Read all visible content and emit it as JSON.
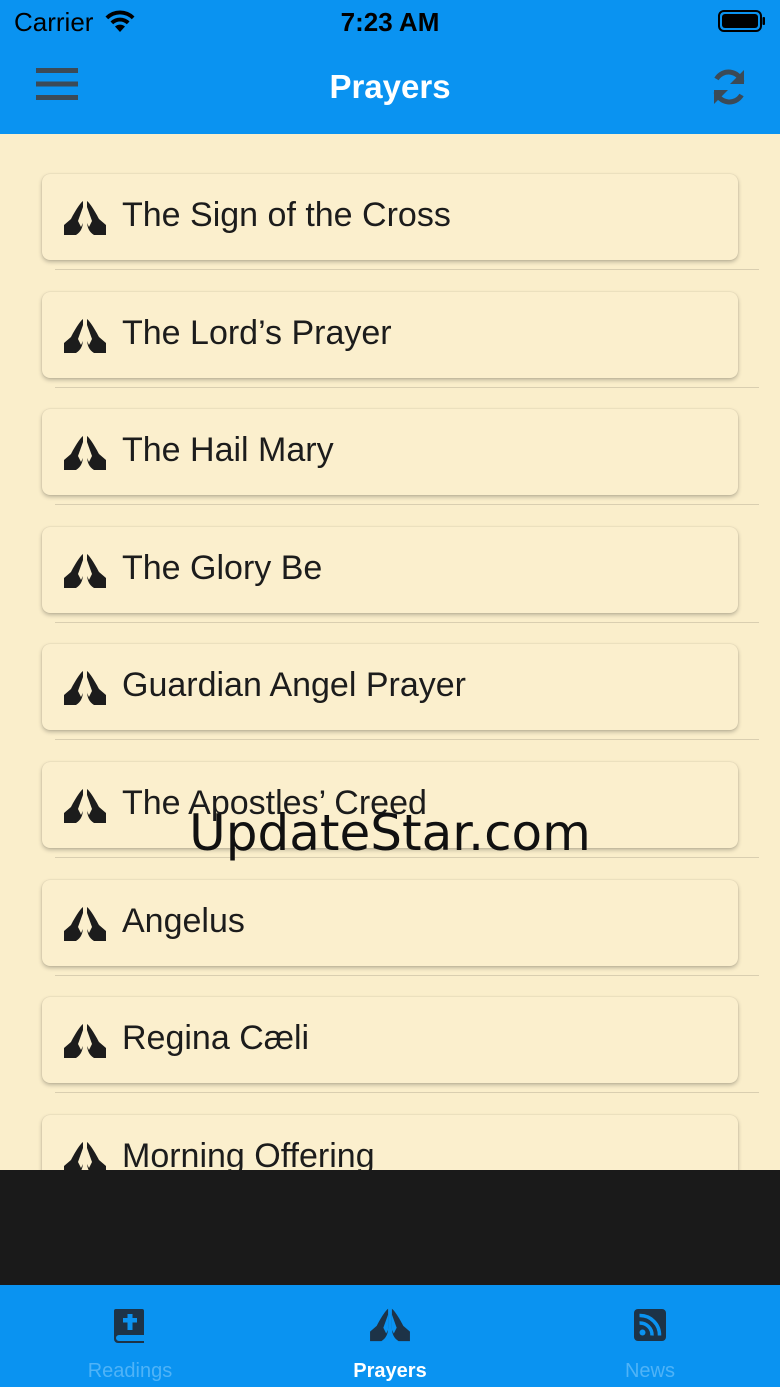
{
  "status_bar": {
    "carrier": "Carrier",
    "time": "7:23 AM"
  },
  "navbar": {
    "title": "Prayers",
    "menu_icon": "hamburger-menu-icon",
    "refresh_icon": "refresh-icon"
  },
  "prayers": [
    {
      "label": "The Sign of the Cross",
      "icon": "praying-hands-icon"
    },
    {
      "label": "The Lord’s Prayer",
      "icon": "praying-hands-icon"
    },
    {
      "label": "The Hail Mary",
      "icon": "praying-hands-icon"
    },
    {
      "label": "The Glory Be",
      "icon": "praying-hands-icon"
    },
    {
      "label": "Guardian Angel Prayer",
      "icon": "praying-hands-icon"
    },
    {
      "label": "The Apostles’ Creed",
      "icon": "praying-hands-icon"
    },
    {
      "label": "Angelus",
      "icon": "praying-hands-icon"
    },
    {
      "label": "Regina Cæli",
      "icon": "praying-hands-icon"
    },
    {
      "label": "Morning Offering",
      "icon": "praying-hands-icon"
    }
  ],
  "watermark": "UpdateStar.com",
  "tabs": [
    {
      "label": "Readings",
      "icon": "bible-icon",
      "active": false
    },
    {
      "label": "Prayers",
      "icon": "praying-hands-icon",
      "active": true
    },
    {
      "label": "News",
      "icon": "rss-icon",
      "active": false
    }
  ],
  "colors": {
    "brand_blue": "#0a93f1",
    "content_background": "#faeecb",
    "inactive_tab_text": "#4fb3f7"
  }
}
